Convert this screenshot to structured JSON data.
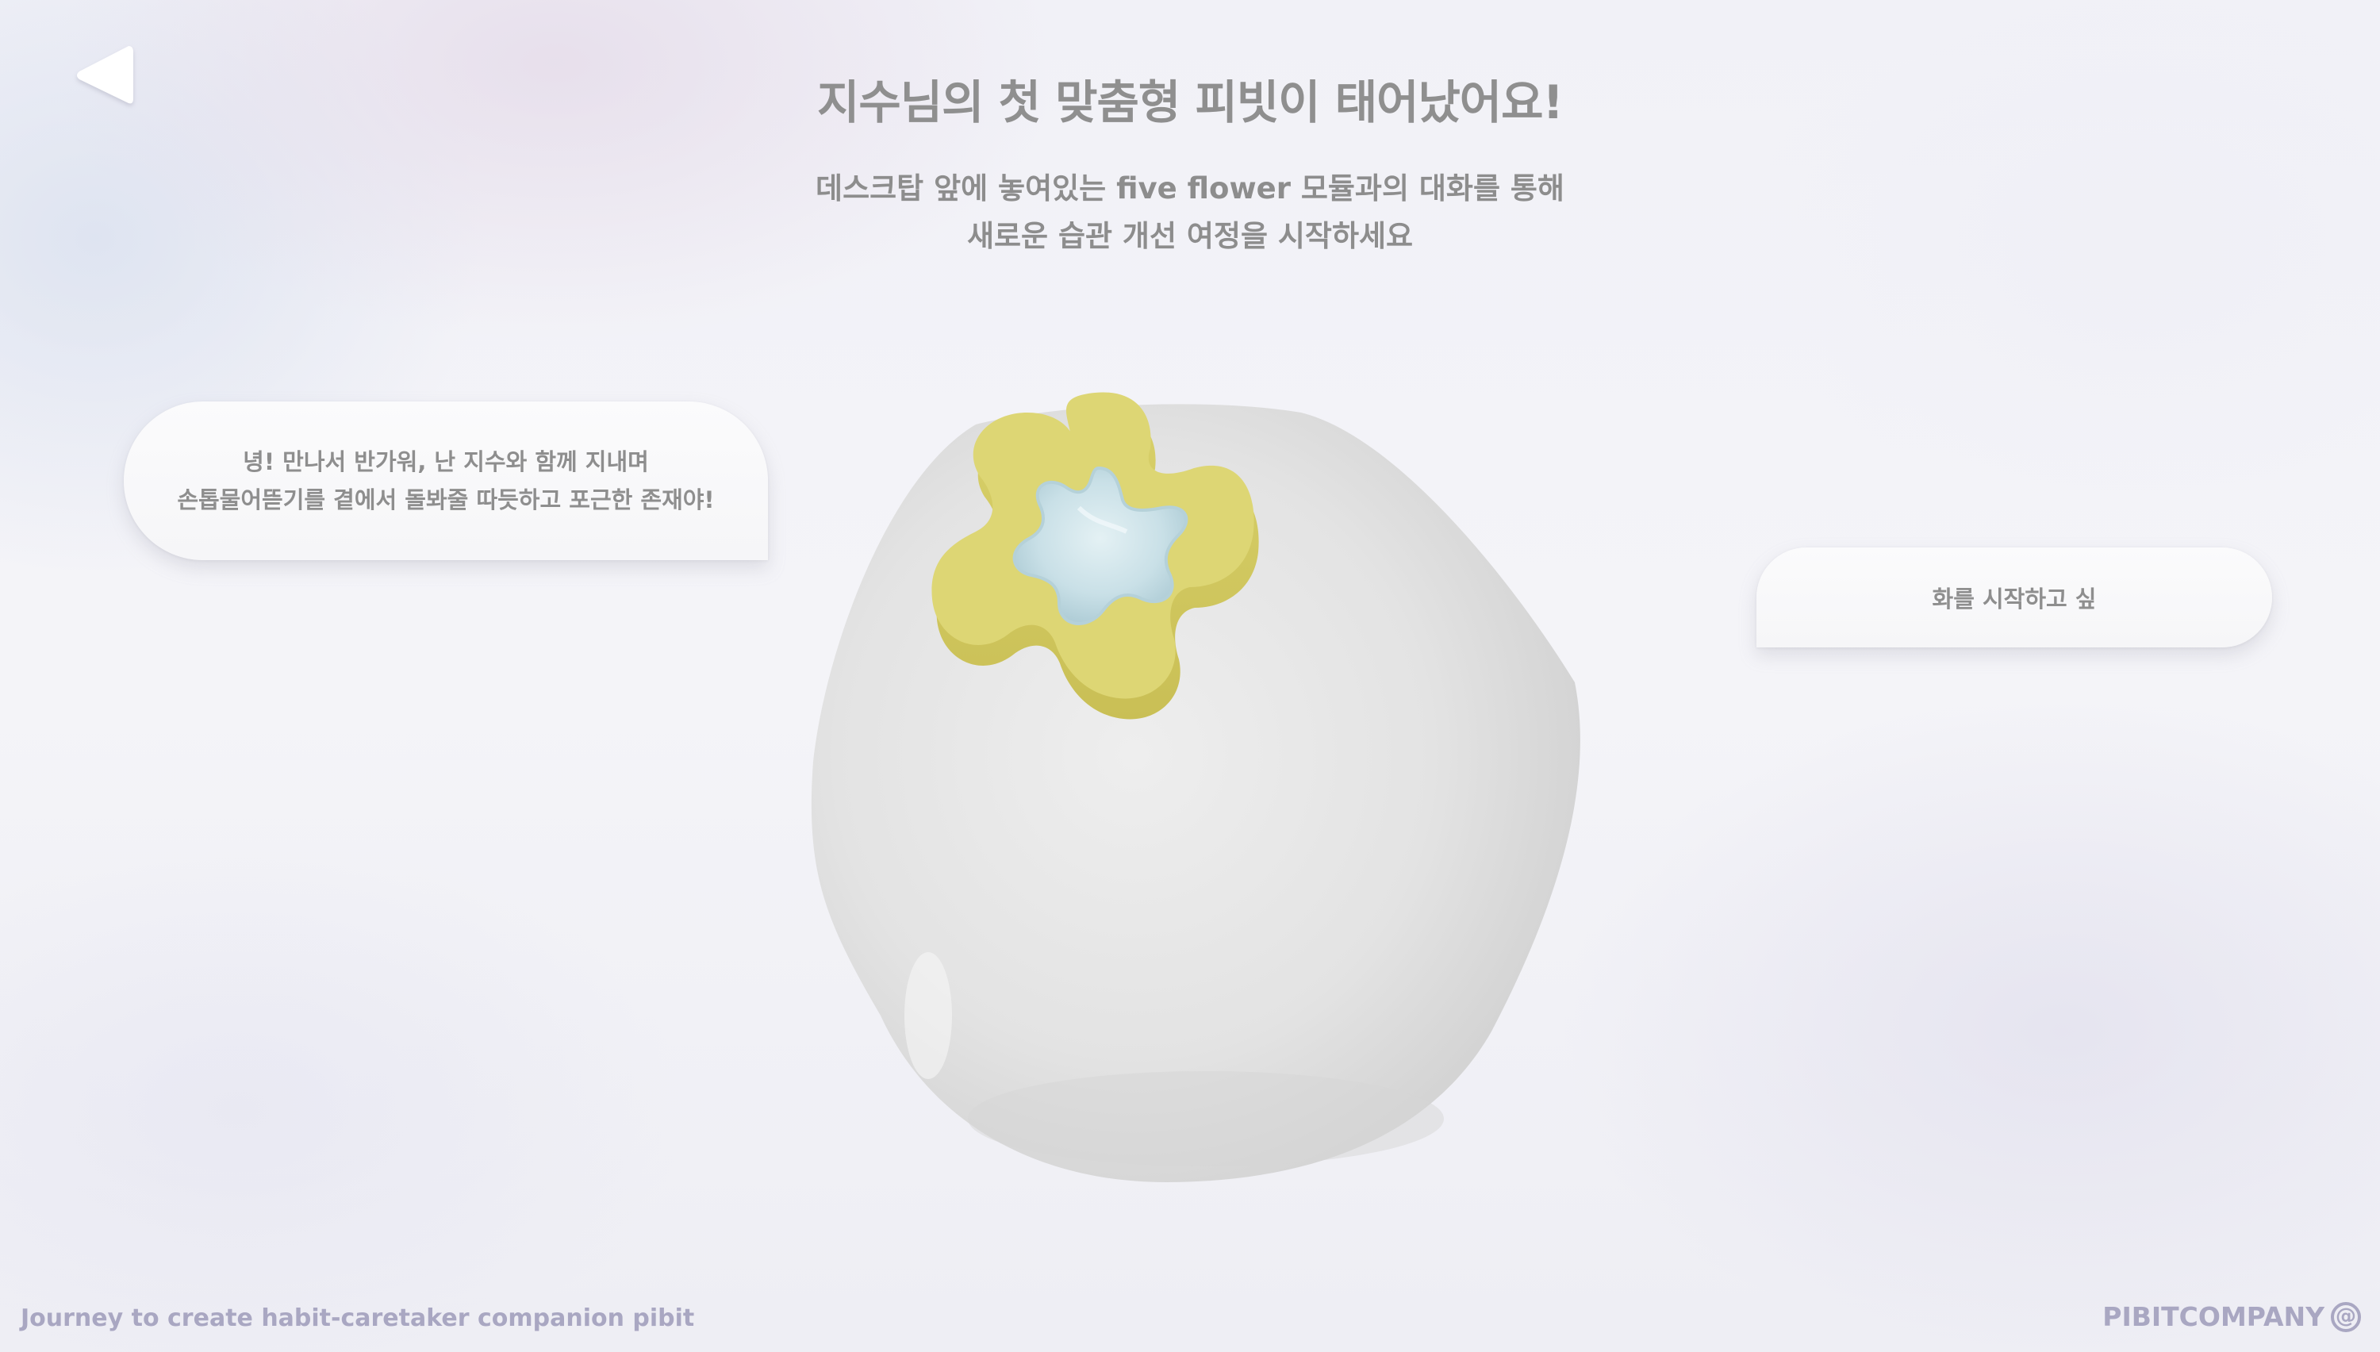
{
  "header": {
    "back_icon": "triangle-left-icon",
    "title": "지수님의 첫 맞춤형 피빗이 태어났어요!",
    "subtitle_lines": [
      "데스크탑 앞에 놓여있는 five flower 모듈과의 대화를 통해",
      "새로운 습관 개선 여정을 시작하세요"
    ]
  },
  "pibit_speech": {
    "lines": [
      "녕! 만나서 반가워, 난 지수와 함께 지내며",
      "손톱물어뜯기를 곁에서 돌봐줄 따듯하고 포근한 존재야!"
    ]
  },
  "user_speech": {
    "text": "화를 시작하고 싶"
  },
  "pibit_model": {
    "body_color": "#e2e2e2",
    "module_name": "five flower",
    "flower_color": "#ddd674",
    "center_color": "#cfe4ea"
  },
  "footer": {
    "tagline": "Journey to create habit-caretaker companion pibit",
    "brand": "PIBITCOMPANY",
    "brand_icon": "at-sign-icon",
    "brand_icon_glyph": "@"
  }
}
